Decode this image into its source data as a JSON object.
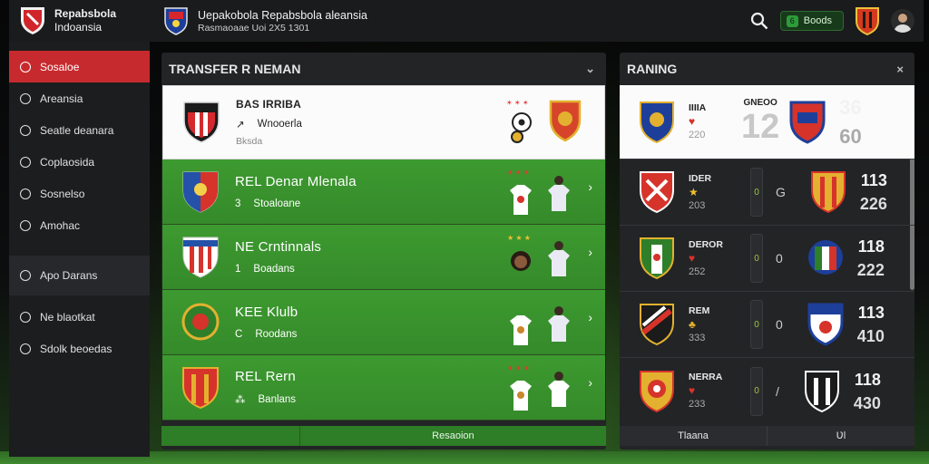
{
  "brand": {
    "line1": "Repabsbola",
    "line2": "Indoansia"
  },
  "app": {
    "title": "Uepakobola Repabsbola aleansia",
    "subtitle": "Rasmaoaae   Uoi  2X5 1301"
  },
  "topbar": {
    "pill_icon": "6",
    "pill_label": "Boods"
  },
  "sidebar": {
    "items": [
      {
        "label": "Sosaloe",
        "icon": "circle-icon",
        "active": true
      },
      {
        "label": "Areansia",
        "icon": "circle-icon"
      },
      {
        "label": "Seatle deanara",
        "icon": "circle-icon"
      },
      {
        "label": "Coplaosida",
        "icon": "circle-icon"
      },
      {
        "label": "Sosnelso",
        "icon": "circle-icon"
      },
      {
        "label": "Amohac",
        "icon": "circle-icon"
      }
    ],
    "group": [
      {
        "label": "Apo Darans",
        "icon": "circle-icon"
      },
      {
        "label": "Ne blaotkat",
        "icon": "circle-icon"
      },
      {
        "label": "Sdolk beoedas",
        "icon": "circle-icon"
      }
    ]
  },
  "transfer": {
    "title": "TRANSFER R NEMAN",
    "rows": [
      {
        "name": "BAS IRRIBA",
        "sub_icon": "↗",
        "sub": "Wnooerla",
        "sub2": "Bksda",
        "style": "first"
      },
      {
        "name": "REL Denar Mlenala",
        "sub_icon": "3",
        "sub": "Stoaloane",
        "style": "green"
      },
      {
        "name": "NE Crntinnals",
        "sub_icon": "1",
        "sub": "Boadans",
        "style": "green"
      },
      {
        "name": "KEE Klulb",
        "sub_icon": "C",
        "sub": "Roodans",
        "style": "green"
      },
      {
        "name": "REL Rern",
        "sub_icon": "⁂",
        "sub": "Banlans",
        "style": "green"
      }
    ],
    "footer": {
      "left": "",
      "right": "Resaoion"
    }
  },
  "ranking": {
    "title": "RANING",
    "rows": [
      {
        "code": "IIIIA",
        "sym": "♥",
        "val": "220",
        "score": "12",
        "right_label": "GNEOO",
        "n1": "36",
        "n2": "60"
      },
      {
        "code": "IDER",
        "sym": "★",
        "val": "203",
        "slot": "0",
        "dot": "G",
        "n1": "113",
        "n2": "226"
      },
      {
        "code": "DEROR",
        "sym": "♥",
        "val": "252",
        "slot": "0",
        "dot": "0",
        "n1": "118",
        "n2": "222"
      },
      {
        "code": "REM",
        "sym": "♣",
        "val": "333",
        "slot": "0",
        "dot": "0",
        "n1": "113",
        "n2": "410"
      },
      {
        "code": "NERRA",
        "sym": "♥",
        "val": "233",
        "slot": "0",
        "dot": "/",
        "n1": "118",
        "n2": "430"
      }
    ],
    "footer": {
      "left": "Tlaana",
      "right": "Ʋl"
    }
  }
}
